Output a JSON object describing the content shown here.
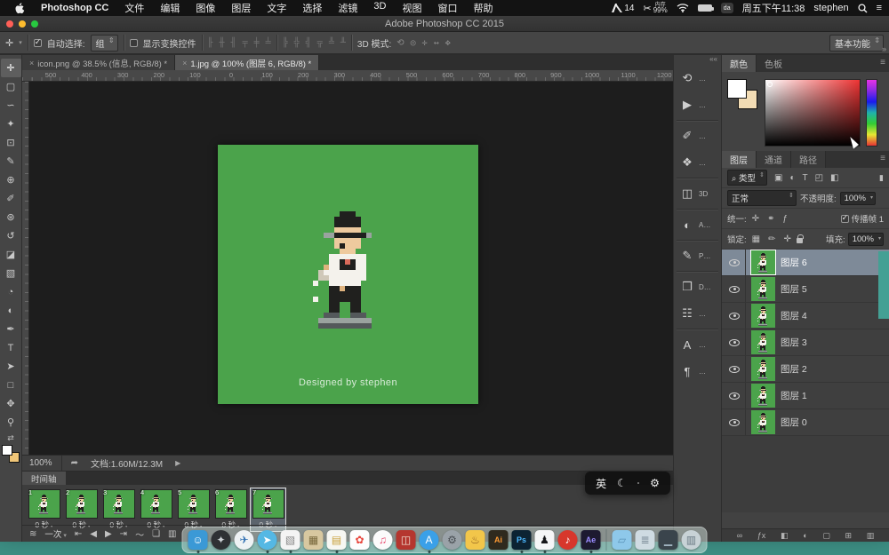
{
  "menubar": {
    "app_name": "Photoshop CC",
    "menus": [
      "文件",
      "编辑",
      "图像",
      "图层",
      "文字",
      "选择",
      "滤镜",
      "3D",
      "视图",
      "窗口",
      "帮助"
    ],
    "status": {
      "cc_badge": "14",
      "mem_label": "内存",
      "mem_value": "99%",
      "time": "周五下午11:38",
      "user": "stephen"
    }
  },
  "window": {
    "title": "Adobe Photoshop CC 2015"
  },
  "options": {
    "move_tool_glyph": "✛",
    "auto_select_label": "自动选择:",
    "auto_select_value": "组",
    "show_transform_label": "显示变换控件",
    "align_icons": [
      "╟",
      "╫",
      "╢",
      "╤",
      "╪",
      "╧"
    ],
    "distribute_icons": [
      "╠",
      "╬",
      "╣",
      "╦",
      "╩",
      "╨"
    ],
    "mode_label": "3D 模式:",
    "mode_icons": [
      "⟲",
      "◎",
      "✛",
      "↔",
      "✥"
    ],
    "workspace": "基本功能"
  },
  "doc_tabs": [
    {
      "label": "icon.png @ 38.5% (信息, RGB/8) *",
      "active": false
    },
    {
      "label": "1.jpg @ 100% (图层 6, RGB/8) *",
      "active": true
    }
  ],
  "ruler_ticks": [
    "500",
    "400",
    "300",
    "200",
    "100",
    "0",
    "100",
    "200",
    "300",
    "400",
    "500",
    "600",
    "700",
    "800",
    "900",
    "1000",
    "1100",
    "1200"
  ],
  "canvas": {
    "green": "#4ba34b",
    "caption": "Designed by stephen"
  },
  "pixel_art": {
    "cols": 13,
    "rows": 22,
    "palette": {
      "K": "#20201e",
      "S": "#eeca9e",
      "W": "#f4f2ec",
      "T": "#dfb37e",
      "C": "#cfc8b8",
      "G": "#9aa39f",
      "D": "#54595b",
      "R": "#d96a5a"
    },
    "grid": [
      ".....KKK.....",
      "....KKKKK....",
      "....KKKKK....",
      "....SSSSS....",
      "..GGKKKKKKG..",
      "....SSSSS....",
      "....SKSSS....",
      ".....SSS.....",
      "...WWWWWWW...",
      "...WWKRKWW...",
      "..TWWKKKWW...",
      ".CWWWWWWWW...",
      ".CCWWWWWWW...",
      "W..WWWWWW....",
      "...KKTKKK....",
      "...KKKKKK....",
      "W..KKKKKK....",
      "...KK..KK....",
      "...KK..KK....",
      "..DDD..DDD...",
      ".GGGGGGGGGG..",
      ".DDDDDDDDDD.."
    ]
  },
  "status": {
    "zoom": "100%",
    "share_glyph": "➦",
    "doc_info": "文档:1.60M/12.3M",
    "arrow": "▶"
  },
  "timeline": {
    "tab": "时间轴",
    "frames": [
      {
        "num": "1",
        "duration": "0 秒"
      },
      {
        "num": "2",
        "duration": "0 秒"
      },
      {
        "num": "3",
        "duration": "0 秒"
      },
      {
        "num": "4",
        "duration": "0 秒"
      },
      {
        "num": "5",
        "duration": "0 秒"
      },
      {
        "num": "6",
        "duration": "0 秒"
      },
      {
        "num": "7",
        "duration": "0 秒",
        "selected": true
      }
    ],
    "loop_value": "一次",
    "controls": [
      {
        "name": "convert-to-video-icon",
        "glyph": "≋"
      },
      {
        "name": "loop-select",
        "label": "一次"
      },
      {
        "name": "first-frame-icon",
        "glyph": "⇤"
      },
      {
        "name": "previous-frame-icon",
        "glyph": "◀"
      },
      {
        "name": "play-icon",
        "glyph": "▶"
      },
      {
        "name": "next-frame-icon",
        "glyph": "⇥"
      },
      {
        "name": "tween-icon",
        "glyph": "〜"
      },
      {
        "name": "duplicate-frame-icon",
        "glyph": "❏"
      },
      {
        "name": "delete-frame-icon",
        "glyph": "▥"
      }
    ]
  },
  "input_overlay": {
    "lang": "英",
    "moon_glyph": "☾",
    "gear_glyph": "⚙"
  },
  "tools": [
    {
      "name": "move-tool",
      "glyph": "✛",
      "selected": true
    },
    {
      "name": "marquee-tool",
      "glyph": "▢"
    },
    {
      "name": "lasso-tool",
      "glyph": "∽"
    },
    {
      "name": "magic-wand-tool",
      "glyph": "✦"
    },
    {
      "name": "crop-tool",
      "glyph": "⊡"
    },
    {
      "name": "eyedropper-tool",
      "glyph": "✎"
    },
    {
      "name": "healing-brush-tool",
      "glyph": "⊕"
    },
    {
      "name": "brush-tool",
      "glyph": "✐"
    },
    {
      "name": "clone-stamp-tool",
      "glyph": "⊛"
    },
    {
      "name": "history-brush-tool",
      "glyph": "↺"
    },
    {
      "name": "eraser-tool",
      "glyph": "◪"
    },
    {
      "name": "gradient-tool",
      "glyph": "▧"
    },
    {
      "name": "blur-tool",
      "glyph": "◔"
    },
    {
      "name": "dodge-tool",
      "glyph": "◐"
    },
    {
      "name": "pen-tool",
      "glyph": "✒"
    },
    {
      "name": "type-tool",
      "glyph": "T"
    },
    {
      "name": "path-select-tool",
      "glyph": "➤"
    },
    {
      "name": "shape-tool",
      "glyph": "□"
    },
    {
      "name": "hand-tool",
      "glyph": "✥"
    },
    {
      "name": "zoom-tool",
      "glyph": "⚲"
    }
  ],
  "panel_strip": [
    {
      "name": "history-panel",
      "glyph": "⟲",
      "label": "…"
    },
    {
      "name": "actions-panel",
      "glyph": "▶",
      "label": "…",
      "sep": true
    },
    {
      "name": "brush-settings-panel",
      "glyph": "✐",
      "label": "…"
    },
    {
      "name": "clone-source-panel",
      "glyph": "❖",
      "label": "…",
      "sep": true
    },
    {
      "name": "3d-panel",
      "glyph": "◫",
      "label": "3D",
      "sep": true
    },
    {
      "name": "adjustments-panel",
      "glyph": "◐",
      "label": "A…",
      "sep": true
    },
    {
      "name": "properties-panel",
      "glyph": "✎",
      "label": "P…",
      "sep": true
    },
    {
      "name": "libraries-panel",
      "glyph": "❒",
      "label": "D…"
    },
    {
      "name": "info-panel",
      "glyph": "☷",
      "label": "…",
      "sep": true
    },
    {
      "name": "character-panel",
      "glyph": "A",
      "label": "…"
    },
    {
      "name": "paragraph-panel",
      "glyph": "¶",
      "label": "…"
    }
  ],
  "color_panel": {
    "tabs": [
      "颜色",
      "色板"
    ],
    "collapse_glyph": "»"
  },
  "layers_panel": {
    "tabs": [
      "图层",
      "通道",
      "路径"
    ],
    "search_kind": "类型",
    "filter_icons": [
      "▣",
      "◐",
      "T",
      "◰",
      "◧"
    ],
    "blend": "正常",
    "opacity_label": "不透明度:",
    "opacity": "100%",
    "unify_label": "统一:",
    "unify_icons": [
      "✛",
      "⚭",
      "ƒ"
    ],
    "propagate_label": "传播帧 1",
    "lock_label": "锁定:",
    "lock_icons": [
      "▦",
      "✏",
      "✛"
    ],
    "fill_label": "填充:",
    "fill": "100%",
    "layers": [
      {
        "name": "图层 6",
        "selected": true
      },
      {
        "name": "图层 5"
      },
      {
        "name": "图层 4"
      },
      {
        "name": "图层 3"
      },
      {
        "name": "图层 2"
      },
      {
        "name": "图层 1"
      },
      {
        "name": "图层 0"
      }
    ],
    "footer_icons": [
      {
        "name": "link-layers-icon",
        "glyph": "∞"
      },
      {
        "name": "layer-style-icon",
        "glyph": "ƒx"
      },
      {
        "name": "layer-mask-icon",
        "glyph": "◧"
      },
      {
        "name": "adjustment-layer-icon",
        "glyph": "◐"
      },
      {
        "name": "layer-group-icon",
        "glyph": "▢"
      },
      {
        "name": "new-layer-icon",
        "glyph": "⊞"
      },
      {
        "name": "delete-layer-icon",
        "glyph": "▥"
      }
    ]
  },
  "dock": [
    {
      "name": "finder",
      "bg": "#3b99d6",
      "fg": "#ffffff",
      "glyph": "☺",
      "dot": true
    },
    {
      "name": "launchpad",
      "bg": "#2e3134",
      "fg": "#cfd4d8",
      "glyph": "✦",
      "round": true
    },
    {
      "name": "safari",
      "bg": "#eef2f4",
      "fg": "#2f6fb2",
      "glyph": "✈",
      "round": true
    },
    {
      "name": "twitter",
      "bg": "#55b8e4",
      "fg": "#ffffff",
      "glyph": "➤",
      "round": true,
      "dot": true
    },
    {
      "name": "preview-app",
      "bg": "#f4f4f4",
      "fg": "#888888",
      "glyph": "▧",
      "dot": true
    },
    {
      "name": "checkered-app",
      "bg": "#d8c8a0",
      "fg": "#7a6a3e",
      "glyph": "▦"
    },
    {
      "name": "notes",
      "bg": "#f7f7f2",
      "fg": "#c9a23e",
      "glyph": "▤",
      "dot": true
    },
    {
      "name": "photos",
      "bg": "#fdfdfd",
      "fg": "#e8453c",
      "glyph": "✿"
    },
    {
      "name": "itunes",
      "bg": "#fbfbfb",
      "fg": "#e8456b",
      "glyph": "♫",
      "round": true
    },
    {
      "name": "dictionary",
      "bg": "#b5362f",
      "fg": "#f2e6d8",
      "glyph": "◫"
    },
    {
      "name": "app-store",
      "bg": "#3aa0e8",
      "fg": "#ffffff",
      "glyph": "A",
      "round": true,
      "dot": true
    },
    {
      "name": "system-preferences",
      "bg": "#9aa2a8",
      "fg": "#4a4f54",
      "glyph": "⚙",
      "round": true
    },
    {
      "name": "yellow-app",
      "bg": "#f2c64a",
      "fg": "#8a5a20",
      "glyph": "♨"
    },
    {
      "name": "illustrator",
      "bg": "#2f2a1e",
      "fg": "#ff9a33",
      "glyph": "Ai",
      "text": true
    },
    {
      "name": "photoshop",
      "bg": "#0c2333",
      "fg": "#4db8ff",
      "glyph": "Ps",
      "text": true,
      "dot": true
    },
    {
      "name": "qq",
      "bg": "#f5f6f7",
      "fg": "#16171a",
      "glyph": "♟",
      "dot": true
    },
    {
      "name": "red-music-app",
      "bg": "#d7372c",
      "fg": "#ffffff",
      "glyph": "♪",
      "round": true
    },
    {
      "name": "after-effects",
      "bg": "#1d1a30",
      "fg": "#9b8cff",
      "glyph": "Ae",
      "text": true,
      "dot": true
    },
    {
      "sep": true
    },
    {
      "name": "folder-blue",
      "bg": "#8ec8ea",
      "fg": "#5a93b8",
      "glyph": "▱"
    },
    {
      "name": "folder-stack",
      "bg": "#cfdbe2",
      "fg": "#7a8a96",
      "glyph": "≣"
    },
    {
      "name": "minimized-window",
      "bg": "#3a444c",
      "fg": "#9fb2bf",
      "glyph": "▁"
    },
    {
      "name": "trash",
      "bg": "#c8d2d6",
      "fg": "#6a7a84",
      "glyph": "▥",
      "round": true
    }
  ]
}
